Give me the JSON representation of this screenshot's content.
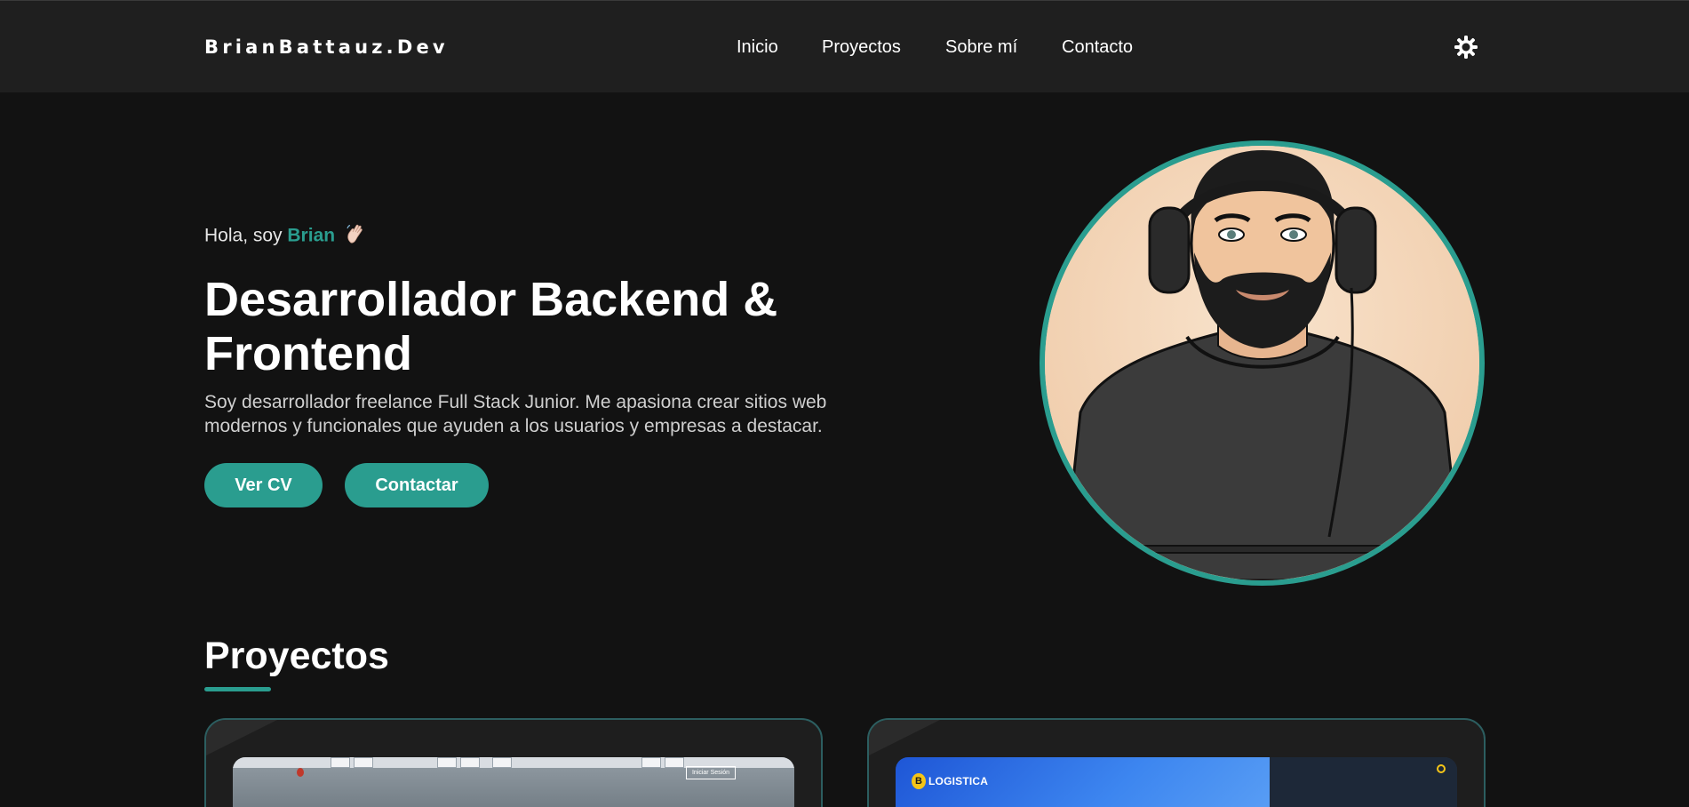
{
  "header": {
    "brand": "BrianBattauz.Dev",
    "nav": [
      {
        "label": "Inicio"
      },
      {
        "label": "Proyectos"
      },
      {
        "label": "Sobre mí"
      },
      {
        "label": "Contacto"
      }
    ],
    "theme_toggle_icon": "sun-icon"
  },
  "hero": {
    "greeting_prefix": "Hola, soy",
    "greeting_name": "Brian",
    "wave_icon": "waving-hand-icon",
    "headline": "Desarrollador Backend & Frontend",
    "description": "Soy desarrollador freelance Full Stack Junior. Me apasiona crear sitios web modernos y funcionales que ayuden a los usuarios y empresas a destacar.",
    "buttons": {
      "cv": "Ver CV",
      "contact": "Contactar"
    },
    "avatar_icon": "avatar-illustration"
  },
  "projects": {
    "title": "Proyectos",
    "cards": [
      {
        "preview_login_label": "Iniciar Sesión"
      },
      {
        "preview_logo_letter": "B",
        "preview_brand": "LOGISTICA"
      }
    ]
  },
  "colors": {
    "accent": "#2a9d8f",
    "background": "#121212",
    "navbar": "#1f1f1f",
    "card_border": "#2c5e60"
  }
}
